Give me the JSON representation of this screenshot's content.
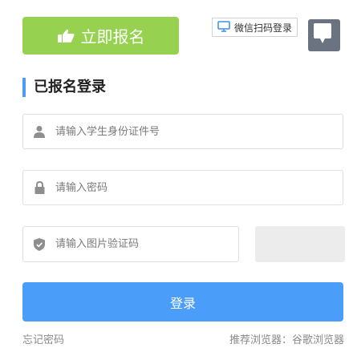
{
  "header": {
    "register_label": "立即报名",
    "qr_login_label": "微信扫码登录"
  },
  "login": {
    "title": "已报名登录",
    "id_placeholder": "请输入学生身份证件号",
    "password_placeholder": "请输入密码",
    "captcha_placeholder": "请输入图片验证码",
    "submit_label": "登录"
  },
  "footer": {
    "forgot_label": "忘记密码",
    "browser_tip": "推荐浏览器：谷歌浏览器"
  },
  "colors": {
    "register_green": "#96d250",
    "primary_blue": "#4a9df8",
    "accent_bar": "#4a9cf7"
  }
}
